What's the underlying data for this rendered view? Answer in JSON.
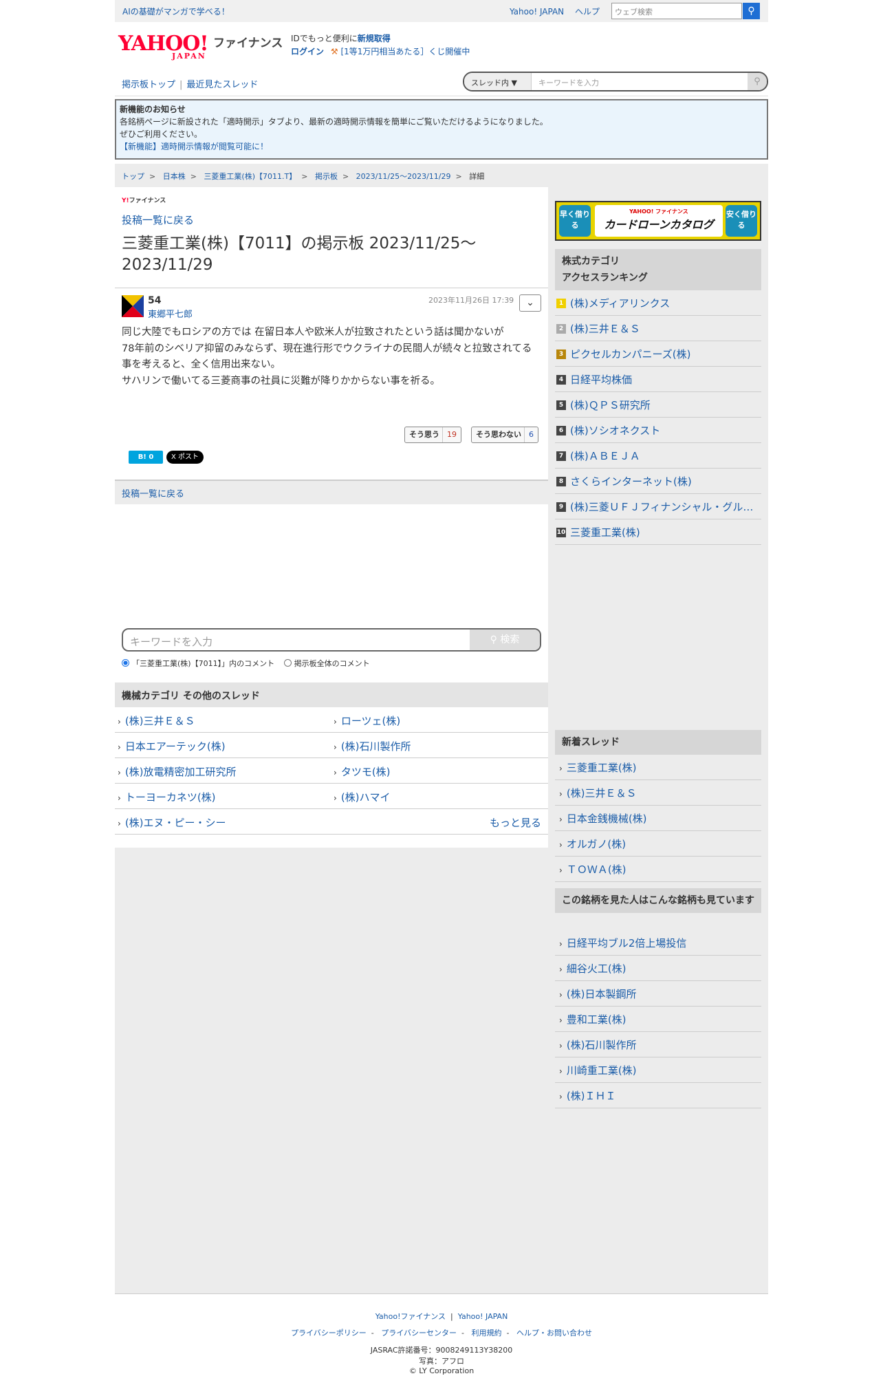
{
  "topbar": {
    "promo": "AIの基礎がマンガで学べる！",
    "links": [
      "Yahoo! JAPAN",
      "ヘルプ"
    ],
    "search_placeholder": "ウェブ検索"
  },
  "header": {
    "logo": "YAHOO!",
    "logo_sub": "JAPAN",
    "service": "ファイナンス",
    "id_text": "IDでもっと便利に",
    "id_link": "新規取得",
    "login": "ログイン",
    "campaign": "[1等1万円相当あたる］くじ開催中"
  },
  "nav": {
    "board_top": "掲示板トップ",
    "recent": "最近見たスレッド",
    "scope": "スレッド内",
    "keyword_placeholder": "キーワードを入力"
  },
  "notice": {
    "title": "新機能のお知らせ",
    "line1": "各銘柄ページに新設された「適時開示」タブより、最新の適時開示情報を簡単にご覧いただけるようになりました。",
    "line2": "ぜひご利用ください。",
    "link": "【新機能】適時開示情報が閲覧可能に！"
  },
  "breadcrumb": [
    "トップ",
    "日本株",
    "三菱重工業(株)【7011.T】",
    "掲示板",
    "2023/11/25〜2023/11/29",
    "詳細"
  ],
  "post": {
    "mini_logo_y": "Y!",
    "mini_logo": "ファイナンス",
    "back": "投稿一覧に戻る",
    "title": "三菱重工業(株)【7011】の掲示板 2023/11/25〜2023/11/29",
    "number": "54",
    "author": "東郷平七郎",
    "date": "2023年11月26日 17:39",
    "body": [
      "同じ大陸でもロシアの方では 在留日本人や欧米人が拉致されたという話は聞かないが",
      "78年前のシベリア抑留のみならず、現在進行形でウクライナの民間人が続々と拉致されてる事を考えると、全く信用出来ない。",
      "サハリンで働いてる三菱商事の社員に災難が降りかからない事を祈る。"
    ],
    "agree_label": "そう思う",
    "agree_count": "19",
    "disagree_label": "そう思わない",
    "disagree_count": "6",
    "hatebu": "B! 0",
    "xpost": "X ポスト",
    "back_bar": "投稿一覧に戻る"
  },
  "search": {
    "placeholder": "キーワードを入力",
    "button": "検索",
    "radio1": "「三菱重工業(株)【7011】」内のコメント",
    "radio2": "掲示板全体のコメント"
  },
  "category": {
    "heading": "機械カテゴリ その他のスレッド",
    "threads": [
      [
        "(株)三井Ｅ＆Ｓ",
        "ローツェ(株)"
      ],
      [
        "日本エアーテック(株)",
        "(株)石川製作所"
      ],
      [
        "(株)放電精密加工研究所",
        "タツモ(株)"
      ],
      [
        "トーヨーカネツ(株)",
        "(株)ハマイ"
      ],
      [
        "(株)エヌ・ピー・シー",
        ""
      ]
    ],
    "more": "もっと見る"
  },
  "ad": {
    "left": "早く借りる",
    "right": "安く借りる",
    "small": "YAHOO! ファイナンス",
    "big": "カードローンカタログ"
  },
  "ranking": {
    "heading1": "株式カテゴリ",
    "heading2": "アクセスランキング",
    "items": [
      {
        "n": "1",
        "name": "(株)メディアリンクス",
        "color": "#f0d000"
      },
      {
        "n": "2",
        "name": "(株)三井Ｅ＆Ｓ",
        "color": "#aaaaaa"
      },
      {
        "n": "3",
        "name": "ピクセルカンパニーズ(株)",
        "color": "#b8860b"
      },
      {
        "n": "4",
        "name": "日経平均株価",
        "color": "#444444"
      },
      {
        "n": "5",
        "name": "(株)ＱＰＳ研究所",
        "color": "#444444"
      },
      {
        "n": "6",
        "name": "(株)ソシオネクスト",
        "color": "#444444"
      },
      {
        "n": "7",
        "name": "(株)ＡＢＥＪＡ",
        "color": "#444444"
      },
      {
        "n": "8",
        "name": "さくらインターネット(株)",
        "color": "#444444"
      },
      {
        "n": "9",
        "name": "(株)三菱ＵＦＪフィナンシャル・グループ",
        "color": "#444444"
      },
      {
        "n": "10",
        "name": "三菱重工業(株)",
        "color": "#444444"
      }
    ]
  },
  "new_threads": {
    "heading": "新着スレッド",
    "items": [
      "三菱重工業(株)",
      "(株)三井Ｅ＆Ｓ",
      "日本金銭機械(株)",
      "オルガノ(株)",
      "ＴＯＷＡ(株)"
    ]
  },
  "also_viewed": {
    "heading": "この銘柄を見た人はこんな銘柄も見ています",
    "items": [
      "日経平均ブル2倍上場投信",
      "細谷火工(株)",
      "(株)日本製鋼所",
      "豊和工業(株)",
      "(株)石川製作所",
      "川崎重工業(株)",
      "(株)ＩＨＩ"
    ]
  },
  "footer": {
    "l1": [
      "Yahoo!ファイナンス",
      "Yahoo! JAPAN"
    ],
    "l2": [
      "プライバシーポリシー",
      "プライバシーセンター",
      "利用規約",
      "ヘルプ・お問い合わせ"
    ],
    "jasrac": "JASRAC許諾番号：9008249113Y38200",
    "photo": "写真：アフロ",
    "copyright": "© LY Corporation"
  }
}
